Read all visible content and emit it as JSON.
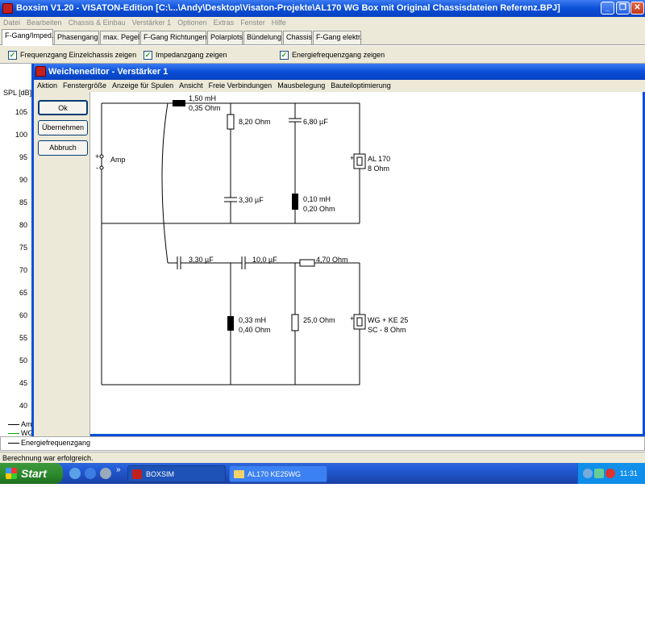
{
  "main_window": {
    "title": "Boxsim V1.20 - VISATON-Edition [C:\\...\\Andy\\Desktop\\Visaton-Projekte\\AL170 WG Box mit Original Chassisdateien Referenz.BPJ]",
    "controls": {
      "minimize": "_",
      "restore": "❐",
      "close": "✕"
    }
  },
  "menubar": [
    "Datei",
    "Bearbeiten",
    "Chassis & Einbau",
    "Verstärker 1",
    "Optionen",
    "Extras",
    "Fenster",
    "Hilfe"
  ],
  "tabs": [
    "F-Gang/Imped.",
    "Phasengang",
    "max. Pegel",
    "F-Gang Richtungen",
    "Polarplots",
    "Bündelung",
    "Chassis",
    "F-Gang elektr."
  ],
  "checkboxes": [
    {
      "label": "Frequenzgang Einzelchassis zeigen",
      "checked": true
    },
    {
      "label": "Impedanzgang zeigen",
      "checked": true
    },
    {
      "label": "Energiefrequenzgang zeigen",
      "checked": true
    }
  ],
  "plot": {
    "ylabel": "SPL [dB]",
    "yticks": [
      "105",
      "100",
      "95",
      "90",
      "85",
      "80",
      "75",
      "70",
      "65",
      "60",
      "55",
      "50",
      "45",
      "40"
    ],
    "legend": [
      {
        "label": "Amp",
        "color": "#000000"
      },
      {
        "label": "WG",
        "color": "#00aa00"
      },
      {
        "label": "Energiefrequenzgang",
        "color": "#000000"
      }
    ]
  },
  "editor": {
    "title": "Weicheneditor - Verstärker 1",
    "menu": [
      "Aktion",
      "Fenstergröße",
      "Anzeige für Spulen",
      "Ansicht",
      "Freie Verbindungen",
      "Mausbelegung",
      "Bauteiloptimierung"
    ],
    "buttons": {
      "ok": "Ok",
      "apply": "Übernehmen",
      "cancel": "Abbruch"
    },
    "schematic": {
      "amp": {
        "label": "Amp",
        "plus": "+",
        "minus": "-"
      },
      "top": {
        "series_inductor": {
          "value": "1,50 mH",
          "resistance": "0,35 Ohm"
        },
        "shunt_resistor": "8,20 Ohm",
        "shunt_capacitor": "3,30 µF",
        "capacitor_upper": "6,80 µF",
        "inductor_lower": {
          "value": "0,10 mH",
          "resistance": "0,20 Ohm"
        },
        "driver": {
          "name": "AL 170",
          "impedance": "8 Ohm"
        }
      },
      "bottom": {
        "series_cap_1": "3,30 µF",
        "series_cap_2": "10,0 µF",
        "series_resistor": "4,70 Ohm",
        "shunt_inductor": {
          "value": "0,33 mH",
          "resistance": "0,40 Ohm"
        },
        "shunt_resistor": "25,0 Ohm",
        "driver": {
          "name": "WG + KE 25",
          "impedance": "SC - 8 Ohm"
        }
      }
    }
  },
  "statusbar": {
    "text": "Berechnung war erfolgreich."
  },
  "taskbar": {
    "start": "Start",
    "quicklaunch_more": "»",
    "tasks": [
      "BOXSIM",
      "AL170 KE25WG"
    ],
    "clock": "11:31"
  }
}
